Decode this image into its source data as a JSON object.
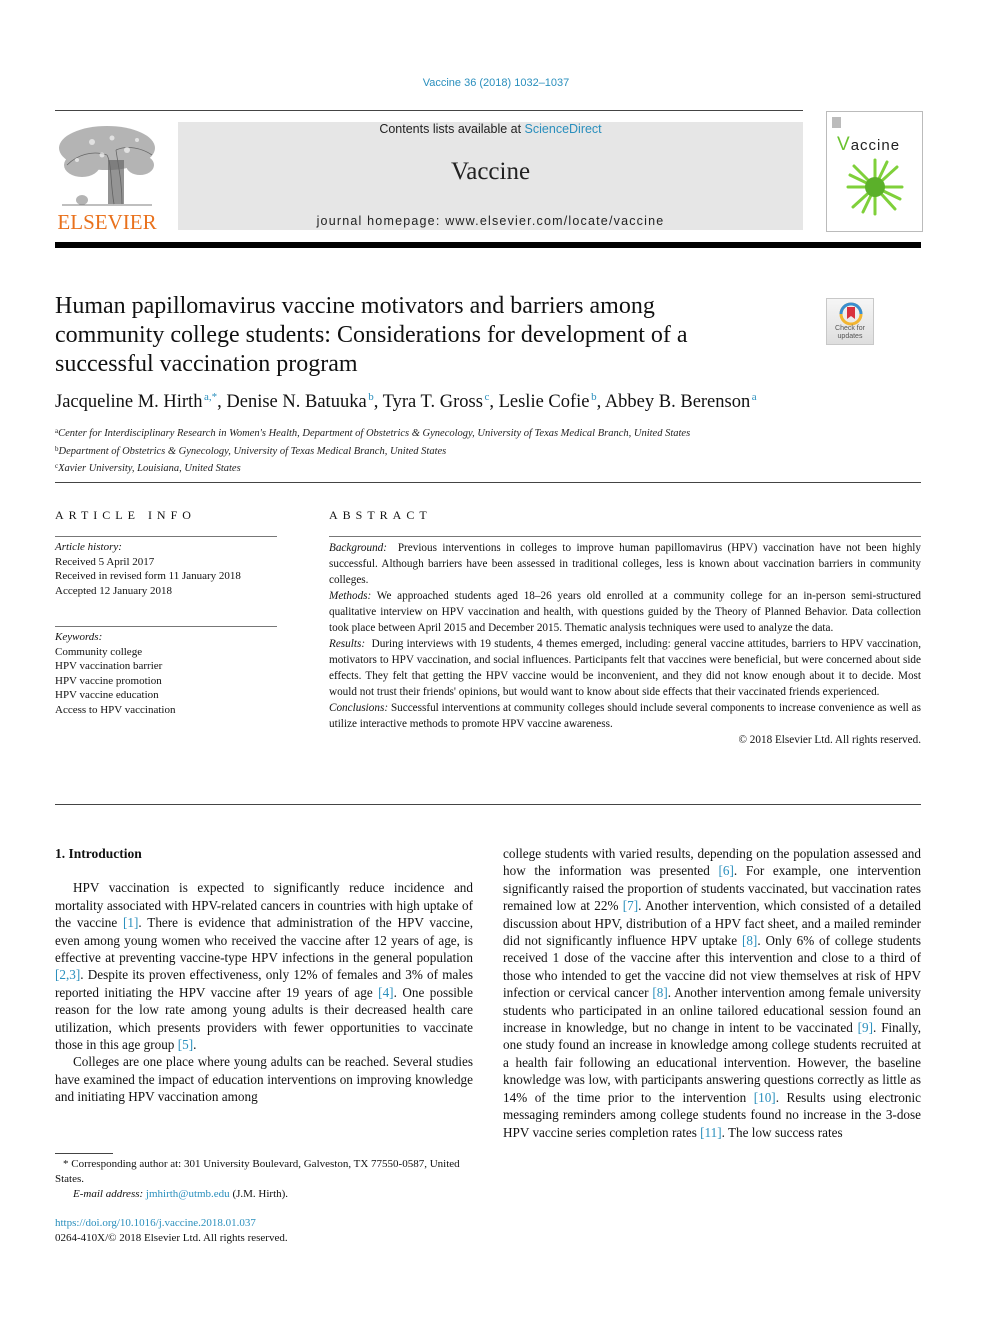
{
  "header": {
    "journal_ref": "Vaccine 36 (2018) 1032–1037",
    "contents_prefix": "Contents lists available at ",
    "contents_link": "ScienceDirect",
    "journal_name": "Vaccine",
    "homepage_prefix": "journal homepage: ",
    "homepage_url": "www.elsevier.com/locate/vaccine",
    "publisher_logo_text": "ELSEVIER",
    "cover_title_initial": "V",
    "cover_title_rest": "accine",
    "check_updates_line1": "Check for",
    "check_updates_line2": "updates"
  },
  "article": {
    "title": "Human papillomavirus vaccine motivators and barriers among community college students: Considerations for development of a successful vaccination program",
    "authors": [
      {
        "name": "Jacqueline M. Hirth",
        "sup": "a,*"
      },
      {
        "name": "Denise N. Batuuka",
        "sup": "b"
      },
      {
        "name": "Tyra T. Gross",
        "sup": "c"
      },
      {
        "name": "Leslie Cofie",
        "sup": "b"
      },
      {
        "name": "Abbey B. Berenson",
        "sup": "a"
      }
    ],
    "affiliations": [
      {
        "mark": "a",
        "text": "Center for Interdisciplinary Research in Women's Health, Department of Obstetrics & Gynecology, University of Texas Medical Branch, United States"
      },
      {
        "mark": "b",
        "text": "Department of Obstetrics & Gynecology, University of Texas Medical Branch, United States"
      },
      {
        "mark": "c",
        "text": "Xavier University, Louisiana, United States"
      }
    ]
  },
  "article_info": {
    "heading": "ARTICLE INFO",
    "history_label": "Article history:",
    "history": [
      "Received 5 April 2017",
      "Received in revised form 11 January 2018",
      "Accepted 12 January 2018"
    ],
    "keywords_label": "Keywords:",
    "keywords": [
      "Community college",
      "HPV vaccination barrier",
      "HPV vaccine promotion",
      "HPV vaccine education",
      "Access to HPV vaccination"
    ]
  },
  "abstract": {
    "heading": "ABSTRACT",
    "sections": [
      {
        "label": "Background:",
        "text": "Previous interventions in colleges to improve human papillomavirus (HPV) vaccination have not been highly successful. Although barriers have been assessed in traditional colleges, less is known about vaccination barriers in community colleges."
      },
      {
        "label": "Methods:",
        "text": "We approached students aged 18–26 years old enrolled at a community college for an in-person semi-structured qualitative interview on HPV vaccination and health, with questions guided by the Theory of Planned Behavior. Data collection took place between April 2015 and December 2015. Thematic analysis techniques were used to analyze the data."
      },
      {
        "label": "Results:",
        "text": "During interviews with 19 students, 4 themes emerged, including: general vaccine attitudes, barriers to HPV vaccination, motivators to HPV vaccination, and social influences. Participants felt that vaccines were beneficial, but were concerned about side effects. They felt that getting the HPV vaccine would be inconvenient, and they did not know enough about it to decide. Most would not trust their friends' opinions, but would want to know about side effects that their vaccinated friends experienced."
      },
      {
        "label": "Conclusions:",
        "text": "Successful interventions at community colleges should include several components to increase convenience as well as utilize interactive methods to promote HPV vaccine awareness."
      }
    ],
    "copyright": "© 2018 Elsevier Ltd. All rights reserved."
  },
  "body": {
    "section_heading": "1. Introduction",
    "left_paragraphs": [
      [
        {
          "t": "HPV vaccination is expected to significantly reduce incidence and mortality associated with HPV-related cancers in countries with high uptake of the vaccine "
        },
        {
          "c": "[1]"
        },
        {
          "t": ". There is evidence that administration of the HPV vaccine, even among young women who received the vaccine after 12 years of age, is effective at preventing vaccine-type HPV infections in the general population "
        },
        {
          "c": "[2,3]"
        },
        {
          "t": ". Despite its proven effectiveness, only 12% of females and 3% of males reported initiating the HPV vaccine after 19 years of age "
        },
        {
          "c": "[4]"
        },
        {
          "t": ". One possible reason for the low rate among young adults is their decreased health care utilization, which presents providers with fewer opportunities to vaccinate those in this age group "
        },
        {
          "c": "[5]"
        },
        {
          "t": "."
        }
      ],
      [
        {
          "t": "Colleges are one place where young adults can be reached. Several studies have examined the impact of education interventions on improving knowledge and initiating HPV vaccination among"
        }
      ]
    ],
    "right_paragraphs": [
      [
        {
          "t": "college students with varied results, depending on the population assessed and how the information was presented "
        },
        {
          "c": "[6]"
        },
        {
          "t": ". For example, one intervention significantly raised the proportion of students vaccinated, but vaccination rates remained low at 22% "
        },
        {
          "c": "[7]"
        },
        {
          "t": ". Another intervention, which consisted of a detailed discussion about HPV, distribution of a HPV fact sheet, and a mailed reminder did not significantly influence HPV uptake "
        },
        {
          "c": "[8]"
        },
        {
          "t": ". Only 6% of college students received 1 dose of the vaccine after this intervention and close to a third of those who intended to get the vaccine did not view themselves at risk of HPV infection or cervical cancer "
        },
        {
          "c": "[8]"
        },
        {
          "t": ". Another intervention among female university students who participated in an online tailored educational session found an increase in knowledge, but no change in intent to be vaccinated "
        },
        {
          "c": "[9]"
        },
        {
          "t": ". Finally, one study found an increase in knowledge among college students recruited at a health fair following an educational intervention. However, the baseline knowledge was low, with participants answering questions correctly as little as 14% of the time prior to the intervention "
        },
        {
          "c": "[10]"
        },
        {
          "t": ". Results using electronic messaging reminders among college students found no increase in the 3-dose HPV vaccine series completion rates "
        },
        {
          "c": "[11]"
        },
        {
          "t": ". The low success rates"
        }
      ]
    ]
  },
  "footnotes": {
    "corresponding": "* Corresponding author at: 301 University Boulevard, Galveston, TX 77550-0587, United States.",
    "email_label": "E-mail address:",
    "email": "jmhirth@utmb.edu",
    "email_suffix": " (J.M. Hirth).",
    "doi": "https://doi.org/10.1016/j.vaccine.2018.01.037",
    "issn_copyright": "0264-410X/© 2018 Elsevier Ltd. All rights reserved."
  },
  "colors": {
    "link": "#2a8fbd",
    "elsevier_orange": "#e9711c",
    "masthead_bg": "#e6e6e6",
    "cover_green": "#6ac22e"
  }
}
